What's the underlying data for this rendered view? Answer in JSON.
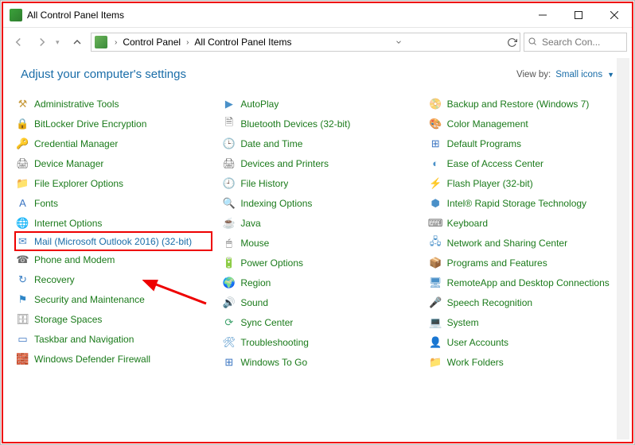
{
  "window": {
    "title": "All Control Panel Items"
  },
  "address": {
    "seg1": "Control Panel",
    "seg2": "All Control Panel Items"
  },
  "search": {
    "placeholder": "Search Con..."
  },
  "header": {
    "title": "Adjust your computer's settings",
    "viewby_label": "View by:",
    "viewby_value": "Small icons"
  },
  "items": [
    {
      "label": "Administrative Tools",
      "iconColor": "#c79b3e",
      "glyph": "⚒"
    },
    {
      "label": "BitLocker Drive Encryption",
      "iconColor": "#d49a2d",
      "glyph": "🔒"
    },
    {
      "label": "Credential Manager",
      "iconColor": "#c8a242",
      "glyph": "🔑"
    },
    {
      "label": "Device Manager",
      "iconColor": "#6b6b6b",
      "glyph": "🖨"
    },
    {
      "label": "File Explorer Options",
      "iconColor": "#d8b45a",
      "glyph": "📁"
    },
    {
      "label": "Fonts",
      "iconColor": "#3c76c2",
      "glyph": "A"
    },
    {
      "label": "Internet Options",
      "iconColor": "#4a90c8",
      "glyph": "🌐"
    },
    {
      "label": "Mail (Microsoft Outlook 2016) (32-bit)",
      "iconColor": "#4a87c6",
      "glyph": "✉",
      "highlight": true
    },
    {
      "label": "Phone and Modem",
      "iconColor": "#6b6b6b",
      "glyph": "☎"
    },
    {
      "label": "Recovery",
      "iconColor": "#3a7fc4",
      "glyph": "↻"
    },
    {
      "label": "Security and Maintenance",
      "iconColor": "#2f86c7",
      "glyph": "⚑"
    },
    {
      "label": "Storage Spaces",
      "iconColor": "#7a7a7a",
      "glyph": "🗄"
    },
    {
      "label": "Taskbar and Navigation",
      "iconColor": "#3c76c2",
      "glyph": "▭"
    },
    {
      "label": "Windows Defender Firewall",
      "iconColor": "#c05a3b",
      "glyph": "🧱"
    },
    {
      "label": "AutoPlay",
      "iconColor": "#4a90c8",
      "glyph": "▶"
    },
    {
      "label": "Bluetooth Devices (32-bit)",
      "iconColor": "#6b6b6b",
      "glyph": "🗎"
    },
    {
      "label": "Date and Time",
      "iconColor": "#4a90c8",
      "glyph": "🕒"
    },
    {
      "label": "Devices and Printers",
      "iconColor": "#6b6b6b",
      "glyph": "🖨"
    },
    {
      "label": "File History",
      "iconColor": "#3ea26c",
      "glyph": "🕘"
    },
    {
      "label": "Indexing Options",
      "iconColor": "#6b6b6b",
      "glyph": "🔍"
    },
    {
      "label": "Java",
      "iconColor": "#c05a3b",
      "glyph": "☕"
    },
    {
      "label": "Mouse",
      "iconColor": "#6b6b6b",
      "glyph": "🖱"
    },
    {
      "label": "Power Options",
      "iconColor": "#3ea26c",
      "glyph": "🔋"
    },
    {
      "label": "Region",
      "iconColor": "#4a90c8",
      "glyph": "🌍"
    },
    {
      "label": "Sound",
      "iconColor": "#6b6b6b",
      "glyph": "🔊"
    },
    {
      "label": "Sync Center",
      "iconColor": "#3ea26c",
      "glyph": "⟳"
    },
    {
      "label": "Troubleshooting",
      "iconColor": "#4a90c8",
      "glyph": "🛠"
    },
    {
      "label": "Windows To Go",
      "iconColor": "#3c76c2",
      "glyph": "⊞"
    },
    {
      "label": "Backup and Restore (Windows 7)",
      "iconColor": "#3ea26c",
      "glyph": "📀"
    },
    {
      "label": "Color Management",
      "iconColor": "#7a7a7a",
      "glyph": "🎨"
    },
    {
      "label": "Default Programs",
      "iconColor": "#3c76c2",
      "glyph": "⊞"
    },
    {
      "label": "Ease of Access Center",
      "iconColor": "#4a90c8",
      "glyph": "◐"
    },
    {
      "label": "Flash Player (32-bit)",
      "iconColor": "#c23b3b",
      "glyph": "⚡"
    },
    {
      "label": "Intel® Rapid Storage Technology",
      "iconColor": "#4a90c8",
      "glyph": "⬢"
    },
    {
      "label": "Keyboard",
      "iconColor": "#6b6b6b",
      "glyph": "⌨"
    },
    {
      "label": "Network and Sharing Center",
      "iconColor": "#4a90c8",
      "glyph": "🖧"
    },
    {
      "label": "Programs and Features",
      "iconColor": "#4a90c8",
      "glyph": "📦"
    },
    {
      "label": "RemoteApp and Desktop Connections",
      "iconColor": "#4a90c8",
      "glyph": "🖥"
    },
    {
      "label": "Speech Recognition",
      "iconColor": "#6b6b6b",
      "glyph": "🎤"
    },
    {
      "label": "System",
      "iconColor": "#4a90c8",
      "glyph": "💻"
    },
    {
      "label": "User Accounts",
      "iconColor": "#c79b3e",
      "glyph": "👤"
    },
    {
      "label": "Work Folders",
      "iconColor": "#d8b45a",
      "glyph": "📁"
    }
  ]
}
